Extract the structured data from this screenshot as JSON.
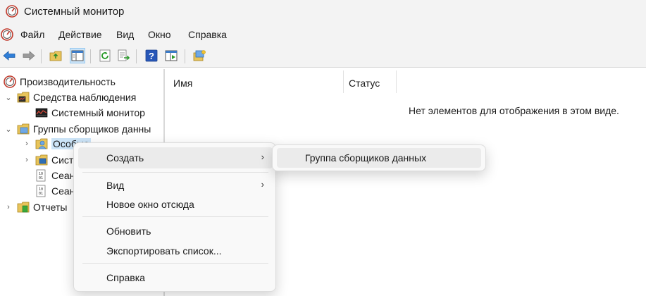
{
  "window": {
    "title": "Системный монитор"
  },
  "menubar": {
    "items": [
      "Файл",
      "Действие",
      "Вид",
      "Окно",
      "Справка"
    ]
  },
  "toolbar": {
    "buttons": [
      "back-icon",
      "forward-icon",
      "up-folder-icon",
      "show-hide-tree-icon",
      "refresh-icon",
      "export-list-icon",
      "help-icon",
      "properties-icon",
      "new-collector-icon"
    ]
  },
  "tree": {
    "root": "Производительность",
    "monitoring_tools": "Средства наблюдения",
    "system_monitor": "Системный монитор",
    "collector_groups": "Группы сборщиков данны",
    "custom": "Особые",
    "system": "Сист",
    "session1": "Сеан",
    "session2": "Сеан",
    "reports": "Отчеты"
  },
  "list": {
    "col_name": "Имя",
    "col_status": "Статус",
    "empty_message": "Нет элементов для отображения в этом виде."
  },
  "context_menu": {
    "create": "Создать",
    "view": "Вид",
    "new_window": "Новое окно отсюда",
    "refresh": "Обновить",
    "export": "Экспортировать список...",
    "help": "Справка",
    "submenu_arrow": "›"
  },
  "submenu": {
    "collector_group": "Группа сборщиков данных"
  },
  "colors": {
    "chrome": "#f3f3f3",
    "selection": "#cce4f7",
    "menu_bg": "#f9f9f9",
    "menu_highlight": "#ebebeb"
  }
}
